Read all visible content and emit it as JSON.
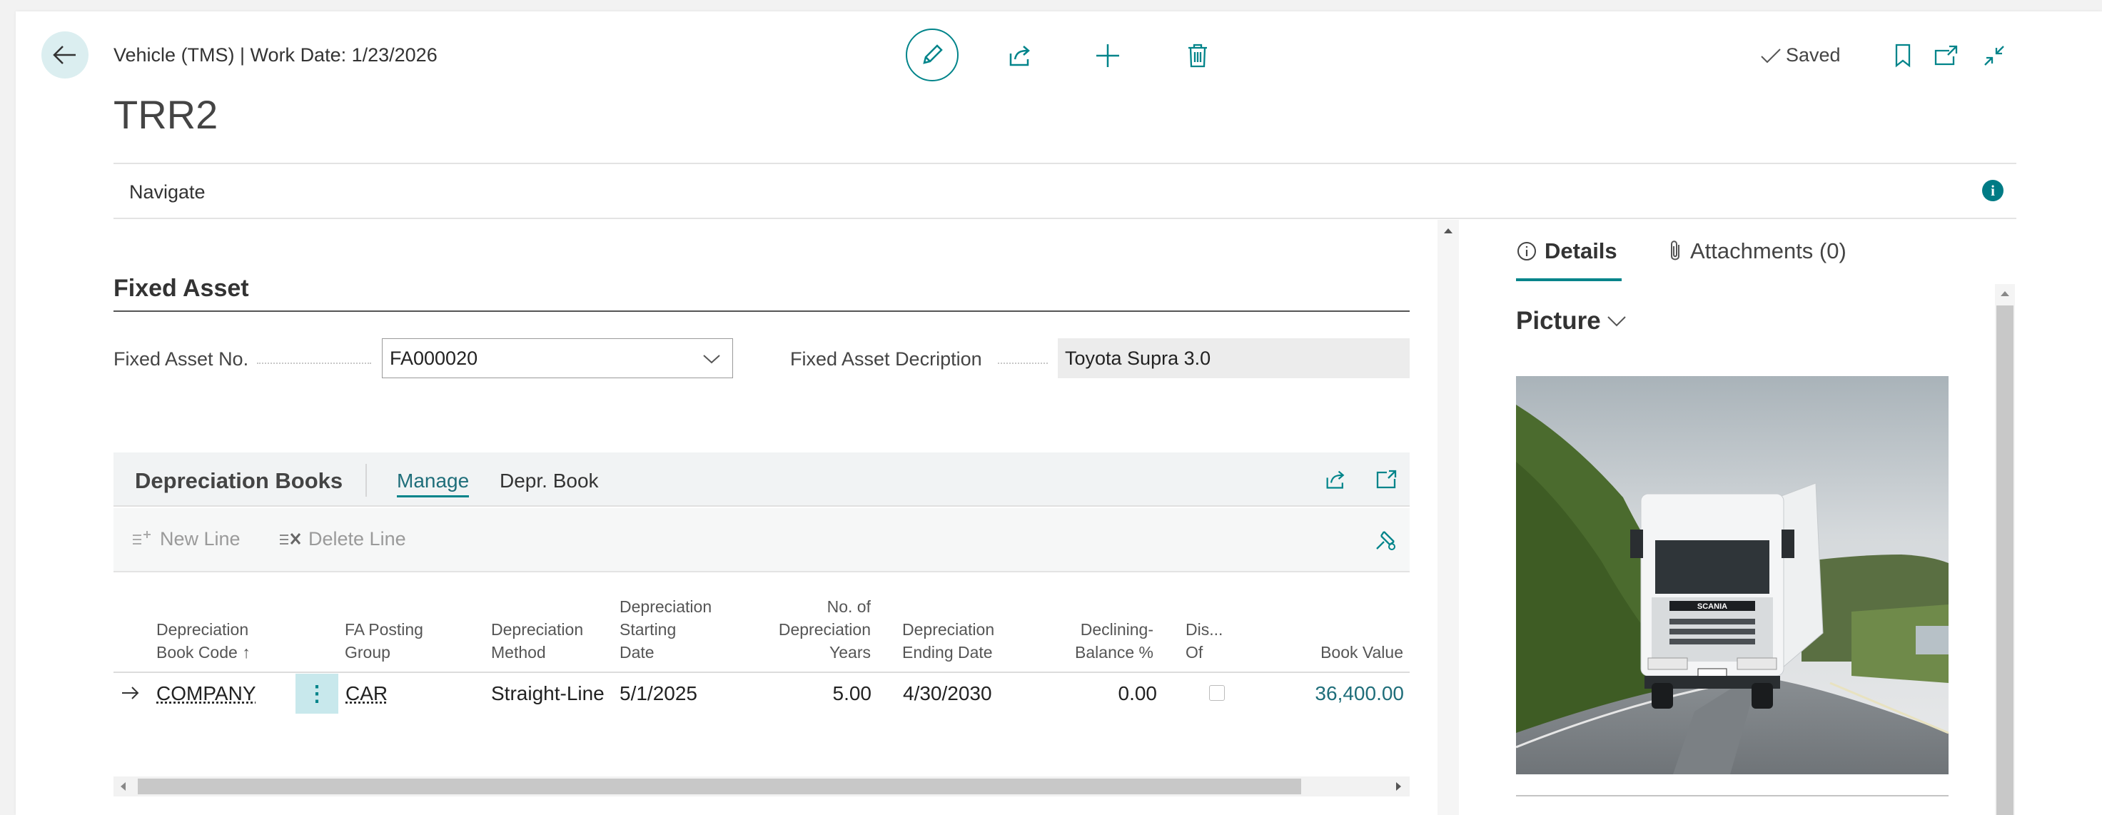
{
  "header": {
    "caption": "Vehicle (TMS) | Work Date: 1/23/2026",
    "title": "TRR2",
    "saved_label": "Saved"
  },
  "actionbar": {
    "navigate_label": "Navigate"
  },
  "fixed_asset": {
    "section_title": "Fixed Asset",
    "no_label": "Fixed Asset No.",
    "no_value": "FA000020",
    "desc_label": "Fixed Asset Decription",
    "desc_value": "Toyota Supra 3.0"
  },
  "depreciation": {
    "title": "Depreciation Books",
    "tab_manage": "Manage",
    "tab_depr_book": "Depr. Book",
    "new_line": "New Line",
    "delete_line": "Delete Line",
    "columns": [
      [
        "Depreciation",
        "Book Code ↑"
      ],
      [
        "FA Posting",
        "Group"
      ],
      [
        "Depreciation",
        "Method"
      ],
      [
        "Depreciation",
        "Starting",
        "Date"
      ],
      [
        "No. of",
        "Depreciation",
        "Years"
      ],
      [
        "Depreciation",
        "Ending Date"
      ],
      [
        "Declining-",
        "Balance %"
      ],
      [
        "Dis...",
        "Of"
      ],
      [
        "Book Value"
      ]
    ],
    "row": {
      "book_code": "COMPANY",
      "posting_group": "CAR",
      "method": "Straight-Line",
      "start_date": "5/1/2025",
      "years": "5.00",
      "end_date": "4/30/2030",
      "declining": "0.00",
      "book_value": "36,400.00"
    }
  },
  "factbox": {
    "details_tab": "Details",
    "attachments_tab": "Attachments (0)",
    "picture_label": "Picture"
  },
  "colors": {
    "accent": "#00848a",
    "link": "#1f6e7a",
    "info": "#007b85"
  }
}
